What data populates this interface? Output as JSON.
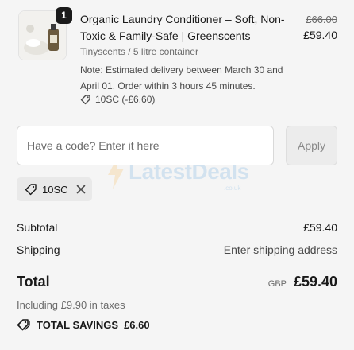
{
  "line_item": {
    "quantity": "1",
    "title": "Organic Laundry Conditioner – Soft, Non-Toxic & Family-Safe | Greenscents",
    "original_price": "£66.00",
    "price": "£59.40",
    "variant": "Tinyscents / 5 litre container",
    "note": "Note: Estimated delivery between March 30 and April 01. Order within 3 hours 45 minutes.",
    "discount": "10SC (-£6.60)",
    "image_icon": "product-bottle-image"
  },
  "discount_form": {
    "placeholder": "Have a code? Enter it here",
    "value": "",
    "apply_label": "Apply"
  },
  "watermark": {
    "text": "LatestDeals",
    "sub": ".co.uk"
  },
  "applied_code": {
    "code": "10SC",
    "icon": "tag-icon",
    "remove_icon": "close-icon"
  },
  "summary": {
    "subtotal_label": "Subtotal",
    "subtotal_value": "£59.40",
    "shipping_label": "Shipping",
    "shipping_value": "Enter shipping address",
    "total_label": "Total",
    "currency": "GBP",
    "total_value": "£59.40",
    "taxes_note": "Including £9.90 in taxes",
    "savings_label": "TOTAL SAVINGS",
    "savings_value": "£6.60"
  },
  "colors": {
    "background": "#f5f5f5",
    "text": "#1a1a1a",
    "muted": "#6b6b6b",
    "chip": "#e9e9e9",
    "watermark": "#3a8fd6"
  }
}
